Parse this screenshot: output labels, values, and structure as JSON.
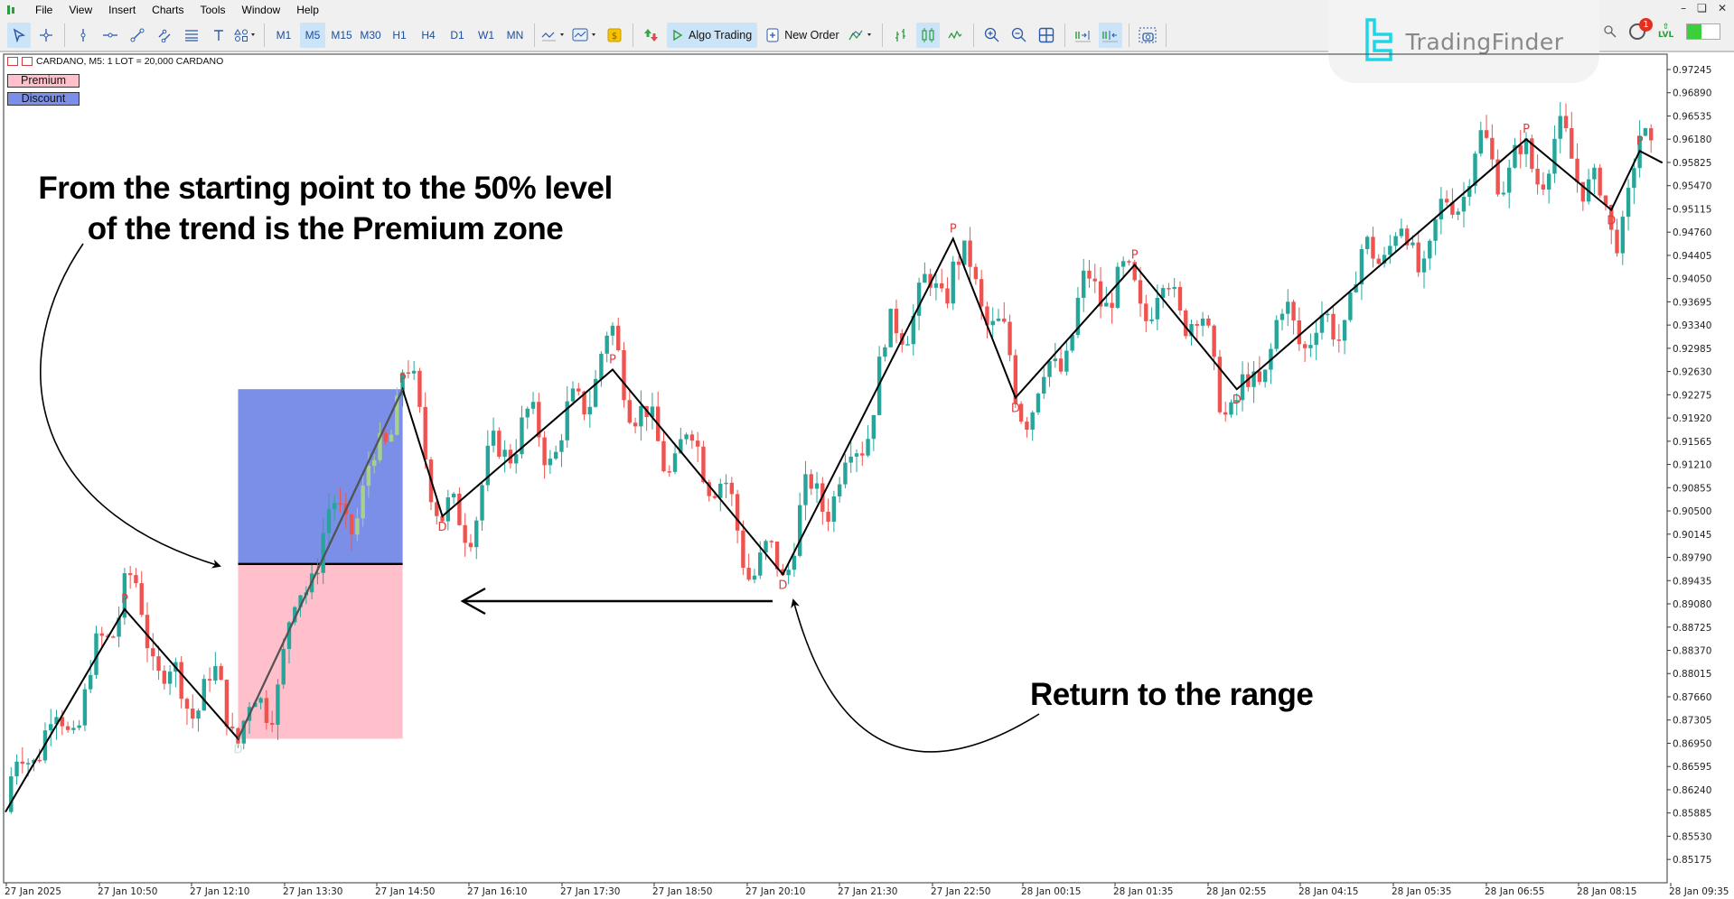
{
  "menubar": {
    "items": [
      "File",
      "View",
      "Insert",
      "Charts",
      "Tools",
      "Window",
      "Help"
    ]
  },
  "toolbar": {
    "timeframes": [
      "M1",
      "M5",
      "M15",
      "M30",
      "H1",
      "H4",
      "D1",
      "W1",
      "MN"
    ],
    "active_timeframe": "M5",
    "algo_trading_label": "Algo Trading",
    "new_order_label": "New Order"
  },
  "branding": {
    "logo_text": "TradingFinder",
    "notification_count": "1",
    "level_label": "LVL",
    "level_progress": 0.45
  },
  "chart_header": {
    "symbol_info": "CARDANO, M5:  1 LOT = 20,000 CARDANO"
  },
  "legend": {
    "premium_label": "Premium",
    "discount_label": "Discount",
    "premium_color": "#ffc0cb",
    "discount_color": "#7b8fe8"
  },
  "annotations": {
    "premium_note_line1": "From the starting point to the 50% level",
    "premium_note_line2": "of the trend is the Premium zone",
    "return_note": "Return to the range"
  },
  "colors": {
    "bull": "#26a69a",
    "bear": "#ef5350",
    "zigzag": "#000000",
    "pivot_label": "#e03c3c",
    "highlight_bull": "#a8d08d"
  },
  "chart_data": {
    "type": "candlestick",
    "title": "CARDANO, M5",
    "xlabel": "",
    "ylabel": "",
    "grid": false,
    "ylim": [
      0.85,
      0.975
    ],
    "y_ticks": [
      "0.97245",
      "0.96890",
      "0.96535",
      "0.96180",
      "0.95825",
      "0.95470",
      "0.95115",
      "0.94760",
      "0.94405",
      "0.94050",
      "0.93695",
      "0.93340",
      "0.92985",
      "0.92630",
      "0.92275",
      "0.91920",
      "0.91565",
      "0.91210",
      "0.90855",
      "0.90500",
      "0.90145",
      "0.89790",
      "0.89435",
      "0.89080",
      "0.88725",
      "0.88370",
      "0.88015",
      "0.87660",
      "0.87305",
      "0.86950",
      "0.86595",
      "0.86240",
      "0.85885",
      "0.85530",
      "0.85175"
    ],
    "x_ticks": [
      "27 Jan 2025",
      "27 Jan 10:50",
      "27 Jan 12:10",
      "27 Jan 13:30",
      "27 Jan 14:50",
      "27 Jan 16:10",
      "27 Jan 17:30",
      "27 Jan 18:50",
      "27 Jan 20:10",
      "27 Jan 21:30",
      "27 Jan 22:50",
      "28 Jan 00:15",
      "28 Jan 01:35",
      "28 Jan 02:55",
      "28 Jan 04:15",
      "28 Jan 05:35",
      "28 Jan 06:55",
      "28 Jan 08:15",
      "28 Jan 09:35"
    ],
    "bars_total": 290,
    "zigzag": [
      {
        "bar": 0,
        "price": 0.859,
        "label": ""
      },
      {
        "bar": 21,
        "price": 0.89,
        "label": "P"
      },
      {
        "bar": 41,
        "price": 0.8702,
        "label": "D"
      },
      {
        "bar": 70,
        "price": 0.9236,
        "label": "P"
      },
      {
        "bar": 77,
        "price": 0.9042,
        "label": "D"
      },
      {
        "bar": 107,
        "price": 0.9266,
        "label": "P"
      },
      {
        "bar": 137,
        "price": 0.8953,
        "label": "D"
      },
      {
        "bar": 167,
        "price": 0.9466,
        "label": "P"
      },
      {
        "bar": 178,
        "price": 0.9223,
        "label": "D"
      },
      {
        "bar": 199,
        "price": 0.9426,
        "label": "P"
      },
      {
        "bar": 217,
        "price": 0.9236,
        "label": "D"
      },
      {
        "bar": 268,
        "price": 0.9618,
        "label": "P"
      },
      {
        "bar": 283,
        "price": 0.951,
        "label": "D"
      },
      {
        "bar": 288,
        "price": 0.96,
        "label": "P"
      },
      {
        "bar": 292,
        "price": 0.9582,
        "label": ""
      }
    ],
    "zones": {
      "start_bar": 41,
      "end_bar": 70,
      "high": 0.9236,
      "low": 0.8702,
      "equilibrium": 0.8969,
      "upper_zone_label": "Discount",
      "lower_zone_label": "Premium"
    }
  }
}
